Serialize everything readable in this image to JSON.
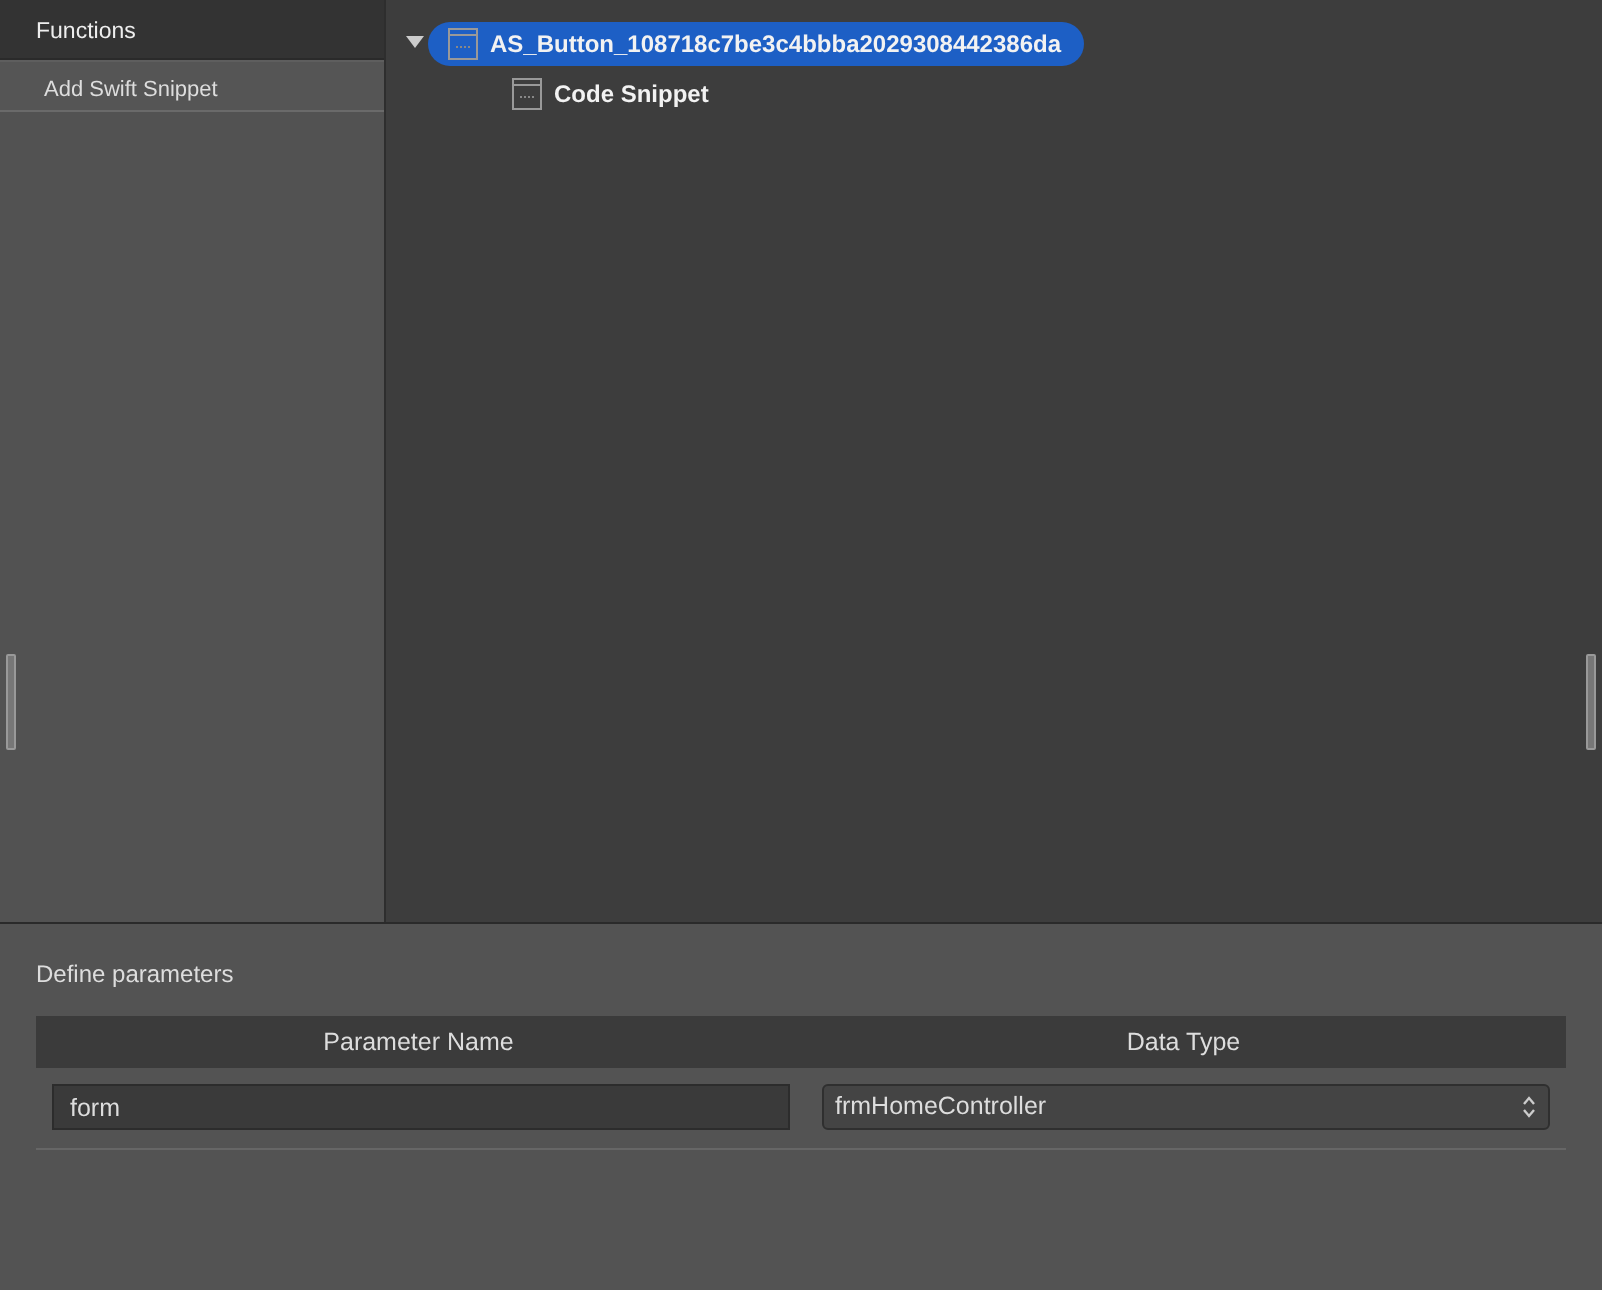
{
  "sidebar": {
    "header": "Functions",
    "items": [
      {
        "label": "Add Swift Snippet",
        "selected": false
      }
    ]
  },
  "tree": [
    {
      "label": "AS_Button_108718c7be3c4bbba2029308442386da",
      "expanded": true,
      "selected": true,
      "children": [
        {
          "label": "Code Snippet",
          "selected": false
        }
      ]
    }
  ],
  "parameters": {
    "title": "Define parameters",
    "columns": [
      "Parameter Name",
      "Data Type"
    ],
    "rows": [
      {
        "name": "form",
        "type": "frmHomeController"
      }
    ]
  }
}
